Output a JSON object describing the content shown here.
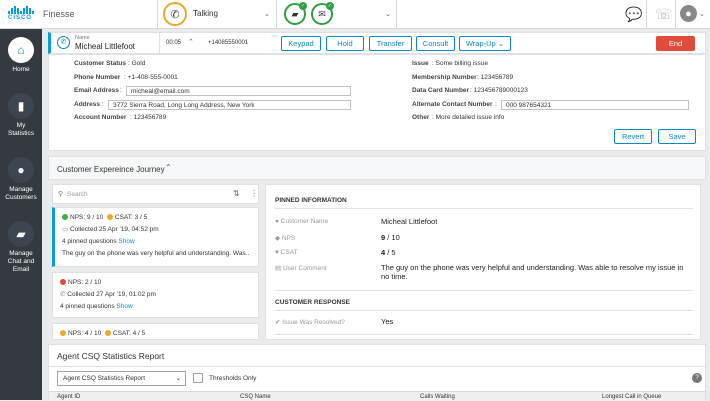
{
  "header": {
    "app_title": "Finesse",
    "status": "Talking"
  },
  "sidebar": {
    "items": [
      {
        "label": "Home"
      },
      {
        "label": "My Statistics"
      },
      {
        "label": "Manage Customers"
      },
      {
        "label": "Manage Chat and Email"
      }
    ]
  },
  "call": {
    "name_label": "Name",
    "name": "Micheal Littlefoot",
    "timer": "00:05",
    "number": "+14085550001",
    "buttons": {
      "keypad": "Keypad",
      "hold": "Hold",
      "transfer": "Transfer",
      "consult": "Consult",
      "wrapup": "Wrap-Up",
      "end": "End"
    }
  },
  "customer": {
    "left": [
      {
        "label": "Customer Status",
        "value": "Gold"
      },
      {
        "label": "Phone Number",
        "value": "+1-408-555-0001"
      },
      {
        "label": "Email Address",
        "value": "micheal@email.com"
      },
      {
        "label": "Address",
        "value": "3772 Sierra Road, Long Long Address, New York"
      },
      {
        "label": "Account Number",
        "value": "123456789"
      }
    ],
    "right": [
      {
        "label": "Issue",
        "value": "Some billing issue"
      },
      {
        "label": "Membership Number",
        "value": "123456789"
      },
      {
        "label": "Data Card Number",
        "value": "123456789000123"
      },
      {
        "label": "Alternate Contact Number",
        "value": "000 987654321"
      },
      {
        "label": "Other",
        "value": "More detailed issue info"
      }
    ],
    "revert": "Revert",
    "save": "Save"
  },
  "journey": {
    "title": "Customer Expereince Journey",
    "search_placeholder": "Search",
    "cards": [
      {
        "nps": "NPS: 9 / 10",
        "csat": "CSAT: 3 / 5",
        "collected": "Collected 25 Apr '19, 04:52 pm",
        "pinned": "4 pinned questions",
        "show": "Show",
        "comment": "The guy on the phone was very helpful and understanding. Was..",
        "nps_color": "#3fae49",
        "csat_color": "#e9a82e"
      },
      {
        "nps": "NPS: 2 / 10",
        "collected": "Collected 27 Apr '19, 01:02 pm",
        "pinned": "4 pinned questions",
        "show": "Show",
        "nps_color": "#e14b3b"
      },
      {
        "nps": "NPS: 4 / 10",
        "csat": "CSAT: 4 / 5",
        "nps_color": "#e9a82e",
        "csat_color": "#e9a82e"
      }
    ],
    "pinned": {
      "title": "PINNED INFORMATION",
      "rows": [
        {
          "label": "Customer Name",
          "value": "Micheal Littlefoot"
        },
        {
          "label": "NPS",
          "value_bold": "9",
          "value_rest": " / 10"
        },
        {
          "label": "CSAT",
          "value_bold": "4",
          "value_rest": " / 5"
        },
        {
          "label": "User Comment",
          "value": "The guy on the phone was very helpful and understanding. Was able to resolve my issue in no time."
        }
      ],
      "response_title": "CUSTOMER RESPONSE",
      "response_label": "Issue Was Resolved?",
      "response_value": "Yes"
    }
  },
  "report": {
    "title": "Agent CSQ Statistics Report",
    "select": "Agent CSQ Statistics Report",
    "threshold": "Thresholds Only",
    "help": "?",
    "columns": [
      "Agent ID",
      "CSQ Name",
      "Calls Waiting",
      "Longest Call in Queue"
    ]
  }
}
